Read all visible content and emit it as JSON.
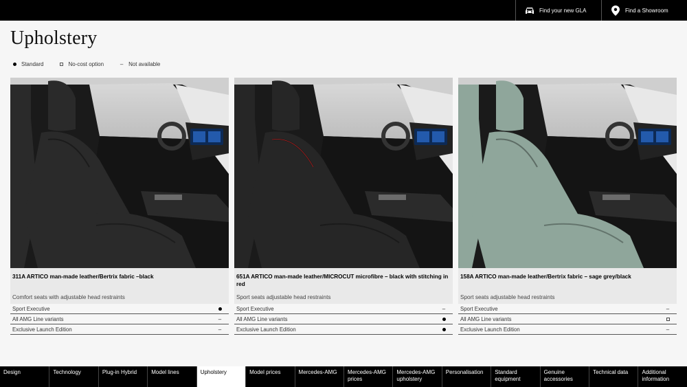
{
  "header": {
    "links": [
      {
        "label": "Find your new GLA",
        "icon": "car-icon"
      },
      {
        "label": "Find a Showroom",
        "icon": "location-pin-icon"
      }
    ]
  },
  "page_title": "Upholstery",
  "legend": [
    {
      "symbol": "dot",
      "label": "Standard"
    },
    {
      "symbol": "box",
      "label": "No-cost option"
    },
    {
      "symbol": "dash",
      "label": "Not available"
    }
  ],
  "cards": [
    {
      "code": "311A  ARTICO man-made leather/Bertrix fabric –black",
      "subtitle": "Comfort seats with adjustable head restraints",
      "seat_color": "#2a2a2a",
      "rows": [
        {
          "label": "Sport Executive",
          "value": "dot"
        },
        {
          "label": "All AMG Line variants",
          "value": "dash"
        },
        {
          "label": "Exclusive Launch Edition",
          "value": "dash"
        }
      ]
    },
    {
      "code": "651A  ARTICO man-made leather/MICROCUT microfibre – black with stitching in red",
      "subtitle": "Sport seats adjustable head restraints",
      "seat_color": "#262626",
      "rows": [
        {
          "label": "Sport Executive",
          "value": "dash"
        },
        {
          "label": "All AMG Line variants",
          "value": "dot"
        },
        {
          "label": "Exclusive Launch Edition",
          "value": "dot"
        }
      ]
    },
    {
      "code": "158A  ARTICO man-made leather/Bertrix fabric – sage grey/black",
      "subtitle": "Sport seats adjustable head restraints",
      "seat_color": "#8fa69b",
      "rows": [
        {
          "label": "Sport Executive",
          "value": "dash"
        },
        {
          "label": "All AMG Line variants",
          "value": "box"
        },
        {
          "label": "Exclusive Launch Edition",
          "value": "dash"
        }
      ]
    }
  ],
  "bottom_nav": [
    {
      "label": "Design",
      "active": false
    },
    {
      "label": "Technology",
      "active": false
    },
    {
      "label": "Plug-in Hybrid",
      "active": false
    },
    {
      "label": "Model lines",
      "active": false
    },
    {
      "label": "Upholstery",
      "active": true
    },
    {
      "label": "Model prices",
      "active": false
    },
    {
      "label": "Mercedes-AMG",
      "active": false
    },
    {
      "label": "Mercedes-AMG prices",
      "active": false
    },
    {
      "label": "Mercedes-AMG upholstery",
      "active": false
    },
    {
      "label": "Personalisation",
      "active": false
    },
    {
      "label": "Standard equipment",
      "active": false
    },
    {
      "label": "Genuine accessories",
      "active": false
    },
    {
      "label": "Technical data",
      "active": false
    },
    {
      "label": "Additional information",
      "active": false
    }
  ]
}
